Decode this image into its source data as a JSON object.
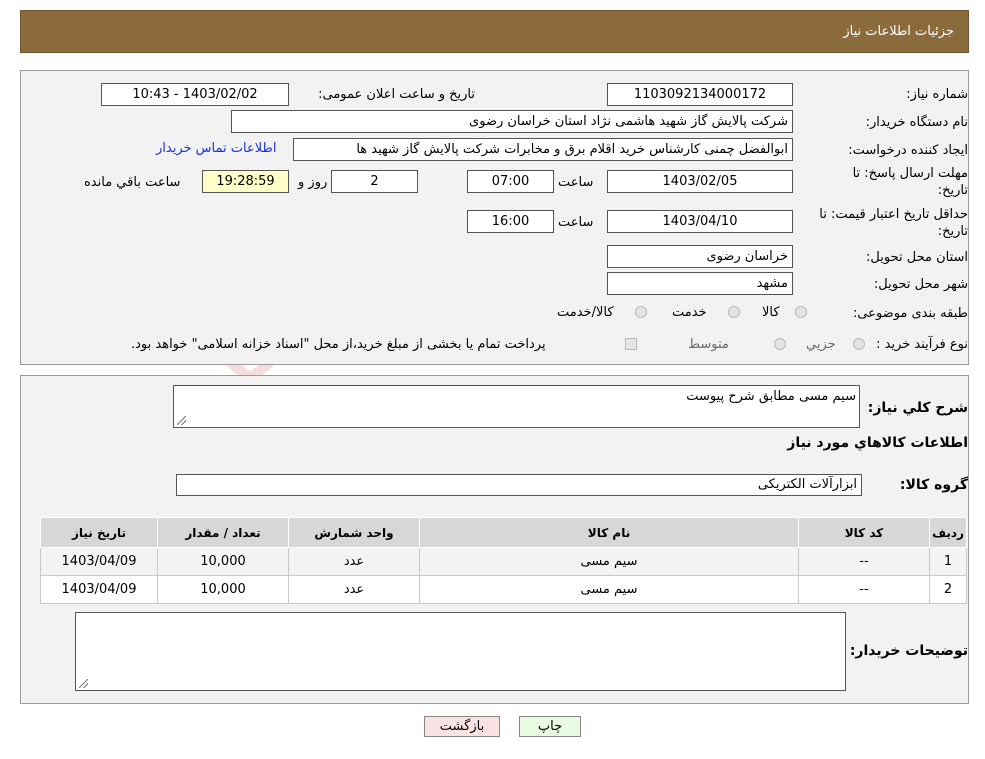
{
  "header": {
    "title": "جزئیات اطلاعات نیاز"
  },
  "form": {
    "need_number_label": "شماره نیاز:",
    "need_number": "1103092134000172",
    "announce_label": "تاریخ و ساعت اعلان عمومی:",
    "announce_value": "1403/02/02 - 10:43",
    "buyer_org_label": "نام دستگاه خریدار:",
    "buyer_org": "شرکت پالایش گاز شهید هاشمی نژاد   استان خراسان رضوی",
    "creator_label": "ایجاد کننده درخواست:",
    "creator": "ابوالفضل چمنی کارشناس خرید اقلام برق و مخابرات شرکت پالایش گاز شهید ها",
    "contact_link": "اطلاعات تماس خریدار",
    "deadline_label_1": "مهلت ارسال پاسخ: تا",
    "deadline_label_2": "تاریخ:",
    "deadline_date": "1403/02/05",
    "time_label": "ساعت",
    "deadline_time": "07:00",
    "days_value": "2",
    "days_label": "روز و",
    "remaining_time": "19:28:59",
    "remaining_label": "ساعت باقي مانده",
    "validity_label_1": "حداقل تاریخ اعتبار قیمت: تا",
    "validity_label_2": "تاریخ:",
    "validity_date": "1403/04/10",
    "validity_time": "16:00",
    "province_label": "استان محل تحویل:",
    "province": "خراسان رضوی",
    "city_label": "شهر محل تحویل:",
    "city": "مشهد",
    "category_label": "طبقه بندی موضوعی:",
    "category_options": [
      "کالا",
      "خدمت",
      "کالا/خدمت"
    ],
    "process_label": "نوع فرآیند خرید :",
    "process_options": [
      "جزیي",
      "متوسط"
    ],
    "payment_note": "پرداخت تمام یا بخشی از مبلغ خرید،از محل \"اسناد خزانه اسلامی\" خواهد بود."
  },
  "details": {
    "summary_label": "شرح کلي نياز:",
    "summary_value": "سیم مسی مطابق شرح پیوست",
    "goods_info_title": "اطلاعات کالاهاي مورد نياز",
    "goods_group_label": "گروه کالا:",
    "goods_group_value": "ابزارآلات الکتریکی",
    "table": {
      "headers": [
        "ردیف",
        "کد کالا",
        "نام کالا",
        "واحد شمارش",
        "تعداد / مقدار",
        "تاریخ نیاز"
      ],
      "rows": [
        [
          "1",
          "--",
          "سیم مسی",
          "عدد",
          "10,000",
          "1403/04/09"
        ],
        [
          "2",
          "--",
          "سیم مسی",
          "عدد",
          "10,000",
          "1403/04/09"
        ]
      ]
    },
    "buyer_notes_label": "توضیحات خریدار:",
    "buyer_notes_value": ""
  },
  "buttons": {
    "print": "چاپ",
    "back": "بازگشت"
  },
  "colors": {
    "header_bg": "#8b6a3b",
    "link": "#1a33cc",
    "remaining_bg": "#ffffc8",
    "back_button_bg": "#fbe3e3",
    "print_button_bg": "#e9fbe3"
  }
}
